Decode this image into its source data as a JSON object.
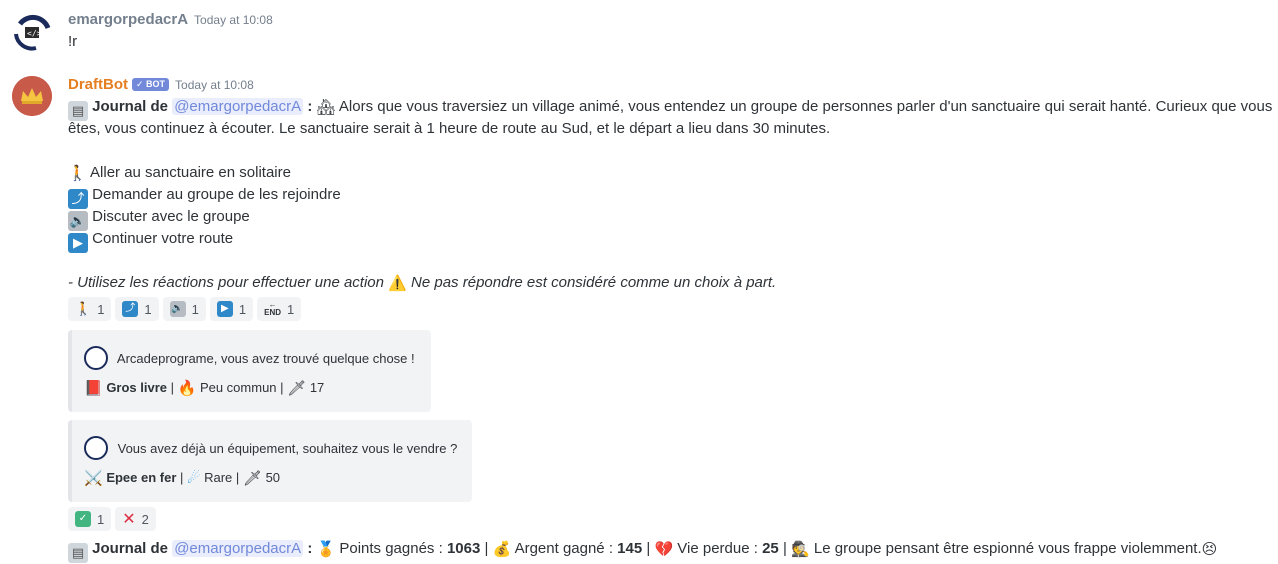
{
  "message1": {
    "author": "emargorpedacrA",
    "timestamp": "Today at 10:08",
    "text": "!r"
  },
  "message2": {
    "author": "DraftBot",
    "bot_tag": "✓ BOT",
    "timestamp": "Today at 10:08",
    "journal_label": "Journal de",
    "mention": "@emargorpedacrA",
    "colon": ":",
    "story_line1": "Alors que vous traversiez un village animé, vous entendez un groupe de personnes parler d'un sanctuaire qui serait hanté. Curieux que vous",
    "story_line2": "êtes, vous continuez à écouter. Le sanctuaire serait à 1 heure de route au Sud, et le départ a lieu dans 30 minutes.",
    "choices": [
      {
        "icon": "walking-person-icon",
        "label": "Aller au sanctuaire en solitaire"
      },
      {
        "icon": "arrow-up-right-icon",
        "label": "Demander au groupe de les rejoindre"
      },
      {
        "icon": "speaker-icon",
        "label": "Discuter avec le groupe"
      },
      {
        "icon": "play-icon",
        "label": "Continuer votre route"
      }
    ],
    "hint_prefix": "- Utilisez les réactions pour effectuer une action",
    "hint_suffix": "Ne pas répondre est considéré comme un choix à part.",
    "reactions": [
      {
        "icon": "walking-person-icon",
        "count": "1"
      },
      {
        "icon": "arrow-up-right-icon",
        "count": "1"
      },
      {
        "icon": "speaker-icon",
        "count": "1"
      },
      {
        "icon": "play-icon",
        "count": "1"
      },
      {
        "icon": "end-arrow-icon",
        "count": "1"
      }
    ],
    "embed1": {
      "title": "Arcadeprograme, vous avez trouvé quelque chose !",
      "item_name": "Gros livre",
      "rarity": "Peu commun",
      "stat": "17"
    },
    "embed2": {
      "title": "Vous avez déjà un équipement, souhaitez vous le vendre ?",
      "item_name": "Epee en fer",
      "rarity": "Rare",
      "stat": "50"
    },
    "reactions2": [
      {
        "icon": "check-icon",
        "count": "1"
      },
      {
        "icon": "cross-icon",
        "count": "2"
      }
    ],
    "result": {
      "journal_label": "Journal de",
      "mention": "@emargorpedacrA",
      "points_label": "Points gagnés :",
      "points_value": "1063",
      "money_label": "Argent gagné :",
      "money_value": "145",
      "life_label": "Vie perdue :",
      "life_value": "25",
      "outcome": "Le groupe pensant être espionné vous frappe violemment."
    }
  },
  "colors": {
    "mention_bg": "#e9edfc",
    "mention_fg": "#7289da",
    "bot_name": "#e67e22",
    "bot_tag": "#7289da",
    "emoji_blue": "#2f88c8",
    "embed_bg": "#f2f3f5"
  }
}
